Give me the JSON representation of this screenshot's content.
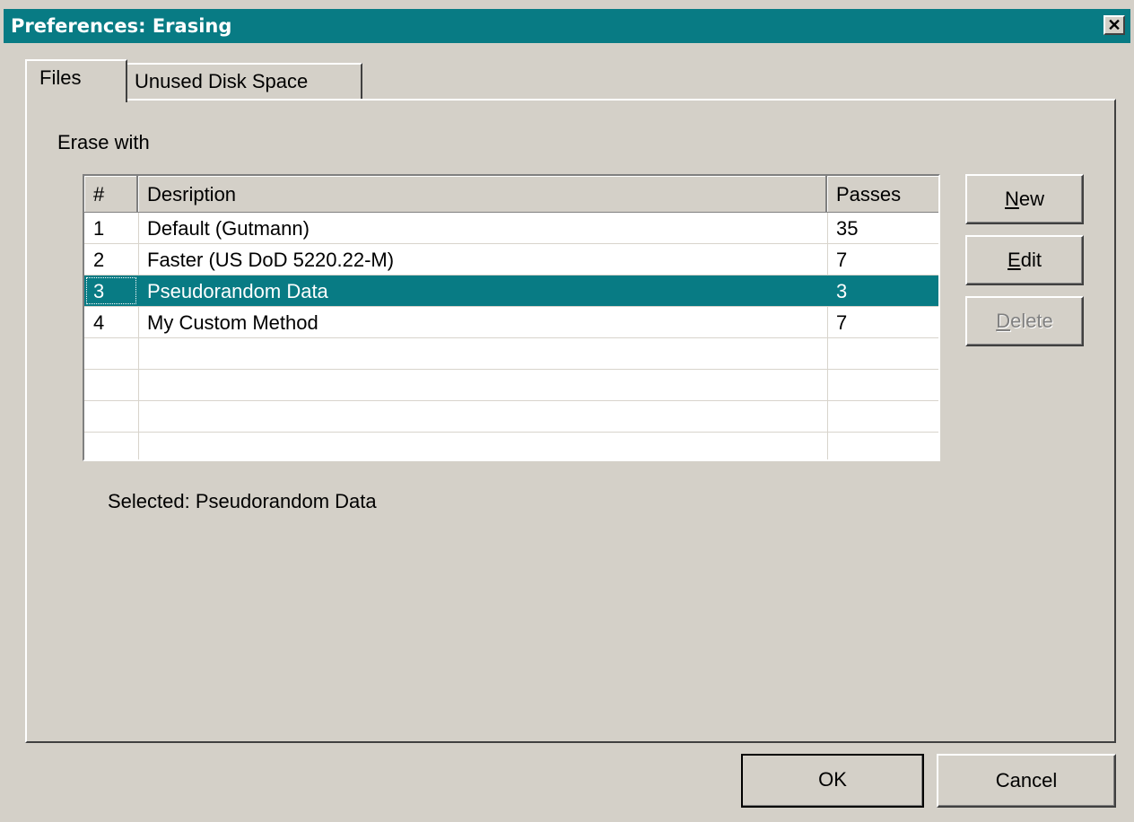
{
  "window": {
    "title": "Preferences: Erasing",
    "close_glyph": "✕"
  },
  "tabs": [
    {
      "label": "Files",
      "active": true
    },
    {
      "label": "Unused Disk Space",
      "active": false
    }
  ],
  "files_tab": {
    "erase_label": "Erase with",
    "columns": {
      "num": "#",
      "description": "Desription",
      "passes": "Passes"
    },
    "rows": [
      {
        "num": "1",
        "description": "Default (Gutmann)",
        "passes": "35"
      },
      {
        "num": "2",
        "description": "Faster (US DoD 5220.22-M)",
        "passes": "7"
      },
      {
        "num": "3",
        "description": "Pseudorandom Data",
        "passes": "3"
      },
      {
        "num": "4",
        "description": "My Custom Method",
        "passes": "7"
      }
    ],
    "selected_row_index": 2,
    "buttons": {
      "new_label": "New",
      "edit_label": "Edit",
      "delete_label": "Delete"
    },
    "selected_text": "Selected: Pseudorandom Data"
  },
  "footer": {
    "ok_label": "OK",
    "cancel_label": "Cancel"
  },
  "colors": {
    "titlebar": "#087b84",
    "selection": "#087b84",
    "face": "#d4d0c8"
  }
}
